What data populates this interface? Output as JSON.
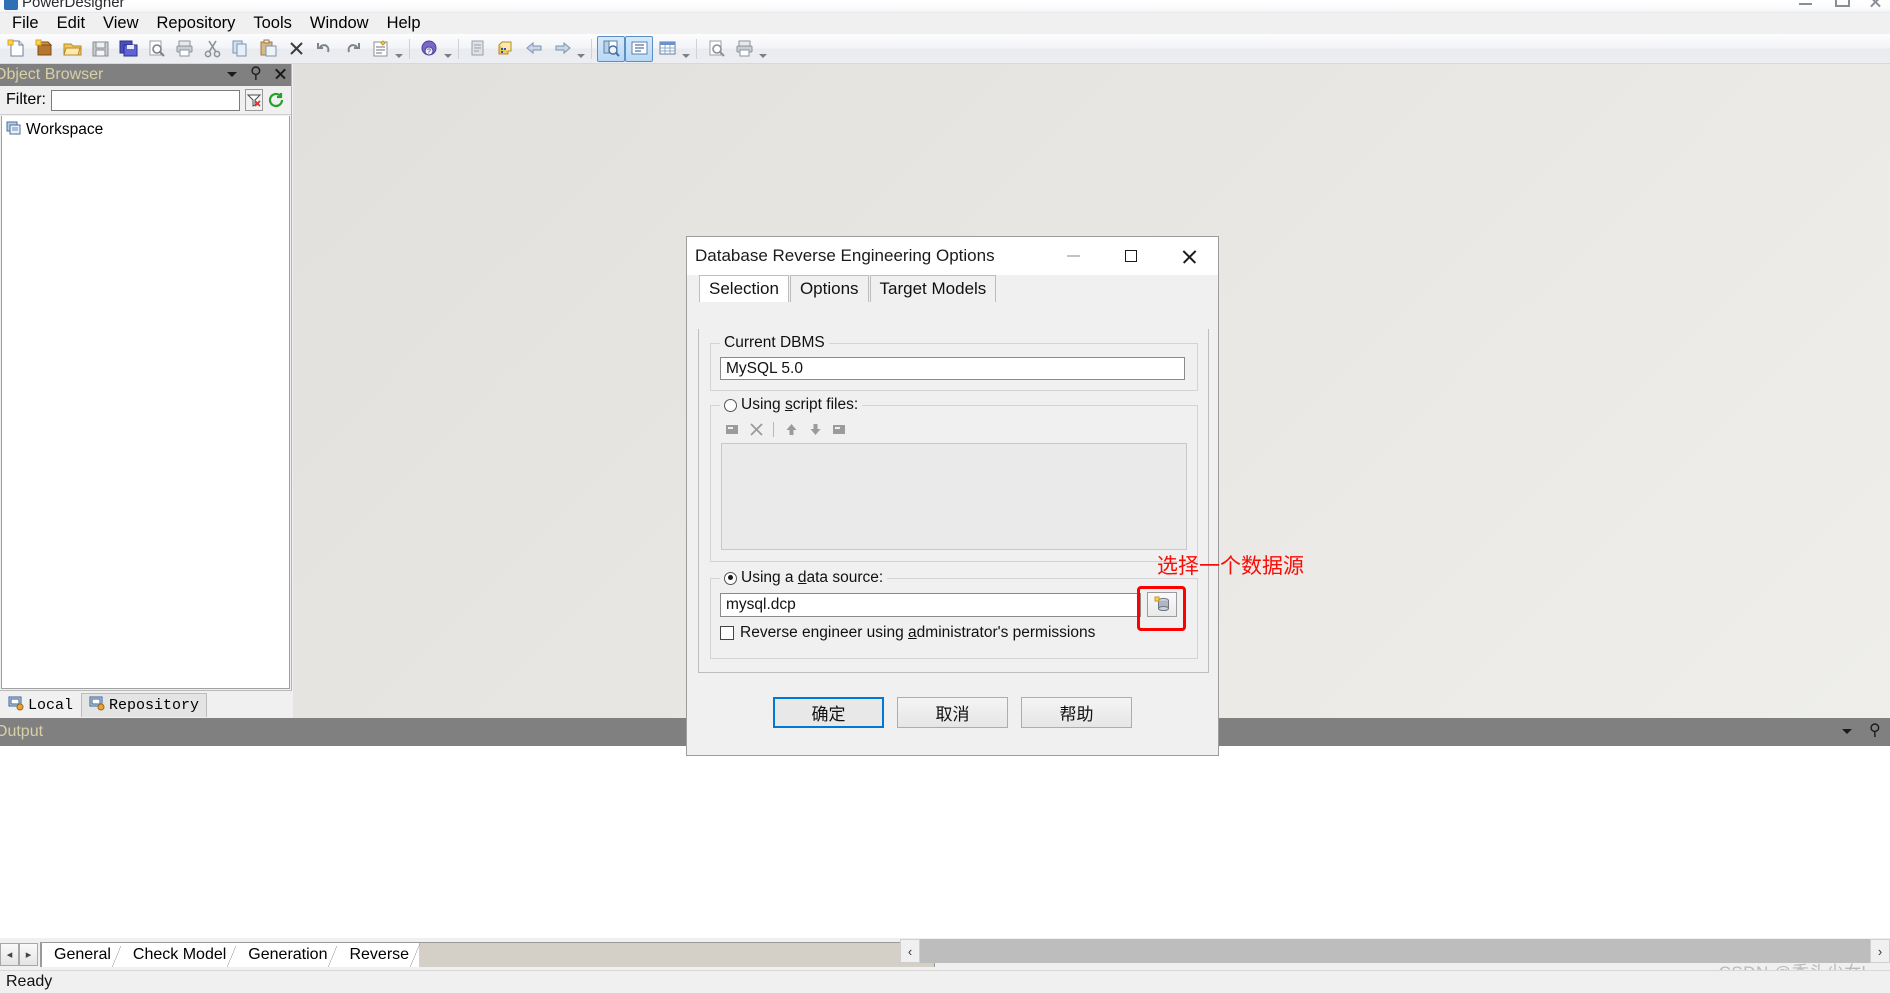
{
  "window": {
    "title": "PowerDesigner",
    "min_label": "minimize",
    "max_label": "maximize",
    "close_label": "close"
  },
  "menubar": {
    "items": [
      {
        "label": "File"
      },
      {
        "label": "Edit"
      },
      {
        "label": "View"
      },
      {
        "label": "Repository"
      },
      {
        "label": "Tools"
      },
      {
        "label": "Window"
      },
      {
        "label": "Help"
      }
    ]
  },
  "toolbar": {
    "groups": [
      {
        "buttons": [
          {
            "icon": "new-document-icon"
          },
          {
            "icon": "new-package-icon"
          },
          {
            "icon": "open-folder-icon"
          },
          {
            "icon": "save-icon"
          },
          {
            "icon": "save-all-icon"
          },
          {
            "icon": "print-preview-icon"
          },
          {
            "icon": "print-icon"
          },
          {
            "icon": "cut-icon"
          },
          {
            "icon": "copy-icon"
          },
          {
            "icon": "paste-icon"
          },
          {
            "icon": "delete-icon"
          },
          {
            "icon": "undo-icon"
          },
          {
            "icon": "redo-icon"
          },
          {
            "icon": "properties-icon"
          }
        ]
      },
      {
        "buttons": [
          {
            "icon": "help-icon"
          }
        ]
      },
      {
        "buttons": [
          {
            "icon": "check-model-icon"
          },
          {
            "icon": "find-objects-icon"
          },
          {
            "icon": "previous-icon"
          },
          {
            "icon": "next-icon"
          }
        ]
      },
      {
        "buttons": [
          {
            "icon": "browser-view-icon",
            "active": true
          },
          {
            "icon": "result-list-icon",
            "active": true
          },
          {
            "icon": "grid-view-icon"
          }
        ]
      },
      {
        "buttons": [
          {
            "icon": "zoom-preview-icon"
          },
          {
            "icon": "print-page-icon"
          }
        ]
      }
    ]
  },
  "object_browser": {
    "title": "Object Browser",
    "filter_label": "Filter:",
    "filter_value": "",
    "filter_placeholder": "",
    "filter_clear_icon": "filter-clear-icon",
    "refresh_icon": "refresh-icon",
    "tree": [
      {
        "label": "Workspace",
        "icon": "workspace-icon"
      }
    ],
    "tabs": [
      {
        "label": "Local",
        "icon": "local-icon",
        "selected": true
      },
      {
        "label": "Repository",
        "icon": "repository-icon",
        "selected": false
      }
    ]
  },
  "output_panel": {
    "title": "Output",
    "content": ""
  },
  "bottom_tabs": {
    "prev_label": "◂",
    "next_label": "▸",
    "items": [
      {
        "label": "General",
        "selected": true
      },
      {
        "label": "Check Model",
        "selected": false
      },
      {
        "label": "Generation",
        "selected": false
      },
      {
        "label": "Reverse",
        "selected": false
      }
    ]
  },
  "scrollbar": {
    "left_arrow": "‹",
    "right_arrow": "›"
  },
  "watermark": "CSDN @秃头少女l",
  "statusbar": {
    "text": "Ready"
  },
  "dialog": {
    "title": "Database Reverse Engineering Options",
    "tabs": [
      {
        "label": "Selection",
        "selected": true
      },
      {
        "label": "Options",
        "selected": false
      },
      {
        "label": "Target Models",
        "selected": false
      }
    ],
    "current_dbms": {
      "legend": "Current DBMS",
      "value": "MySQL 5.0"
    },
    "script_files": {
      "legend": "Using script files:",
      "legend_pre": "Using ",
      "legend_accel": "s",
      "legend_post": "cript files:",
      "selected": false,
      "toolbar": [
        {
          "icon": "add-file-icon"
        },
        {
          "icon": "remove-file-icon"
        },
        {
          "icon": "move-up-icon"
        },
        {
          "icon": "move-down-icon"
        },
        {
          "icon": "edit-file-icon"
        }
      ],
      "files": []
    },
    "data_source": {
      "legend": "Using a data source:",
      "legend_pre": "Using a ",
      "legend_accel": "d",
      "legend_post": "ata source:",
      "selected": true,
      "value": "mysql.dcp",
      "browse_icon": "select-data-source-icon",
      "checkbox": {
        "label": "Reverse engineer using administrator's permissions",
        "label_pre": "Reverse engineer using ",
        "label_accel": "a",
        "label_post": "dministrator's permissions",
        "checked": false
      }
    },
    "buttons": [
      {
        "label": "确定",
        "default": true
      },
      {
        "label": "取消",
        "default": false
      },
      {
        "label": "帮助",
        "default": false
      }
    ]
  },
  "annotation": {
    "text": "选择一个数据源",
    "color": "#fb0d07"
  }
}
